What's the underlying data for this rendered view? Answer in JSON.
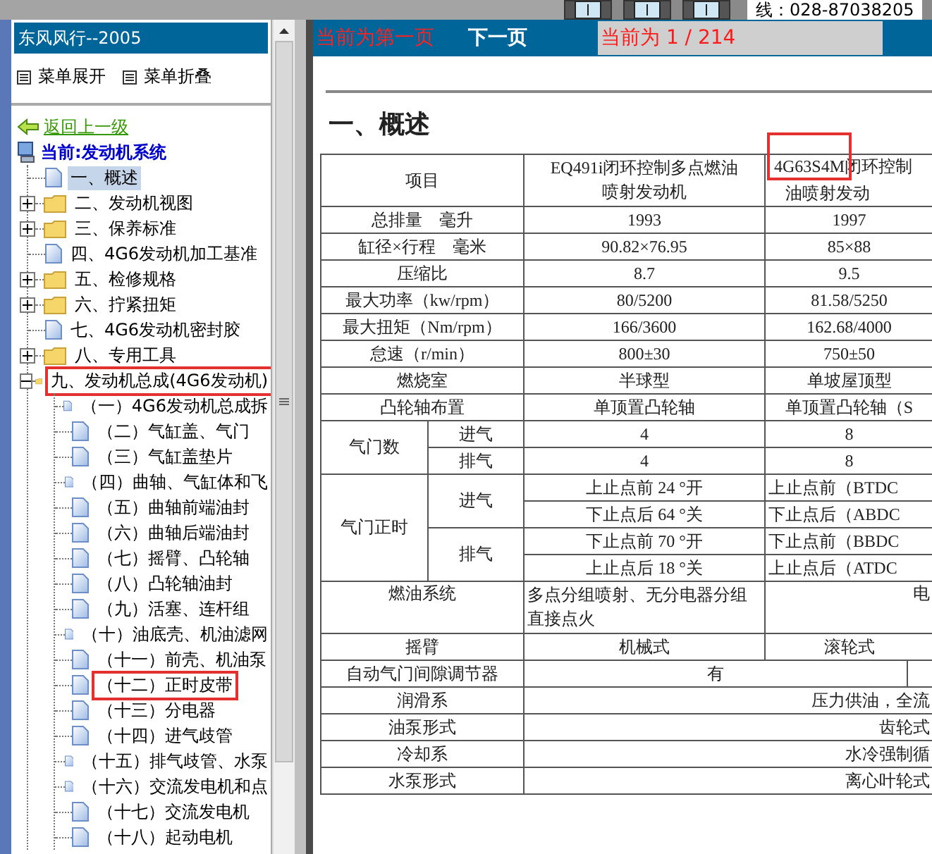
{
  "top_bar": {
    "phone": "线：028-87038205"
  },
  "sidebar": {
    "title": "东风风行--2005",
    "menu_buttons": [
      "菜单展开",
      "菜单折叠"
    ],
    "back_link": "返回上一级",
    "current": "当前:发动机系统",
    "tree": [
      {
        "label": "一、概述",
        "kind": "page",
        "selected": true,
        "highlighted": false
      },
      {
        "label": "二、发动机视图",
        "kind": "folder",
        "expanded": false,
        "selected": false,
        "highlighted": false
      },
      {
        "label": "三、保养标准",
        "kind": "folder",
        "expanded": false,
        "selected": false,
        "highlighted": false
      },
      {
        "label": "四、4G6发动机加工基准",
        "kind": "page",
        "selected": false,
        "highlighted": false
      },
      {
        "label": "五、检修规格",
        "kind": "folder",
        "expanded": false,
        "selected": false,
        "highlighted": false
      },
      {
        "label": "六、拧紧扭矩",
        "kind": "folder",
        "expanded": false,
        "selected": false,
        "highlighted": false
      },
      {
        "label": "七、4G6发动机密封胶",
        "kind": "page",
        "selected": false,
        "highlighted": false
      },
      {
        "label": "八、专用工具",
        "kind": "folder",
        "expanded": false,
        "selected": false,
        "highlighted": false
      },
      {
        "label": "九、发动机总成(4G6发动机)",
        "kind": "folder",
        "expanded": true,
        "selected": false,
        "highlighted": true,
        "children": [
          {
            "label": "（一）4G6发动机总成拆",
            "kind": "page",
            "selected": false,
            "highlighted": false
          },
          {
            "label": "（二）气缸盖、气门",
            "kind": "page",
            "selected": false,
            "highlighted": false
          },
          {
            "label": "（三）气缸盖垫片",
            "kind": "page",
            "selected": false,
            "highlighted": false
          },
          {
            "label": "（四）曲轴、气缸体和飞",
            "kind": "page",
            "selected": false,
            "highlighted": false
          },
          {
            "label": "（五）曲轴前端油封",
            "kind": "page",
            "selected": false,
            "highlighted": false
          },
          {
            "label": "（六）曲轴后端油封",
            "kind": "page",
            "selected": false,
            "highlighted": false
          },
          {
            "label": "（七）摇臂、凸轮轴",
            "kind": "page",
            "selected": false,
            "highlighted": false
          },
          {
            "label": "（八）凸轮轴油封",
            "kind": "page",
            "selected": false,
            "highlighted": false
          },
          {
            "label": "（九）活塞、连杆组",
            "kind": "page",
            "selected": false,
            "highlighted": false
          },
          {
            "label": "（十）油底壳、机油滤网",
            "kind": "page",
            "selected": false,
            "highlighted": false
          },
          {
            "label": "（十一）前壳、机油泵",
            "kind": "page",
            "selected": false,
            "highlighted": false
          },
          {
            "label": "（十二）正时皮带",
            "kind": "page",
            "selected": false,
            "highlighted": true
          },
          {
            "label": "（十三）分电器",
            "kind": "page",
            "selected": false,
            "highlighted": false
          },
          {
            "label": "（十四）进气歧管",
            "kind": "page",
            "selected": false,
            "highlighted": false
          },
          {
            "label": "（十五）排气歧管、水泵",
            "kind": "page",
            "selected": false,
            "highlighted": false
          },
          {
            "label": "（十六）交流发电机和点",
            "kind": "page",
            "selected": false,
            "highlighted": false
          },
          {
            "label": "（十七）交流发电机",
            "kind": "page",
            "selected": false,
            "highlighted": false
          },
          {
            "label": "（十八）起动电机",
            "kind": "page",
            "selected": false,
            "highlighted": false
          }
        ]
      }
    ]
  },
  "content": {
    "prev_status": "当前为第一页",
    "next_link": "下一页",
    "page_indicator": "当前为 1 / 214",
    "heading": "一、概述",
    "table": {
      "header": {
        "label": "项目",
        "columns": [
          {
            "lines": [
              "EQ491i闭环控制多点燃油",
              "喷射发动机"
            ],
            "highlighted": false
          },
          {
            "lines": [
              "4G63S4M闭环控制",
              "油喷射发动"
            ],
            "highlighted": true
          }
        ]
      },
      "rows": [
        {
          "kind": "simple",
          "label": "总排量　毫升",
          "values": [
            "1993",
            "1997"
          ]
        },
        {
          "kind": "simple",
          "label": "缸径×行程　毫米",
          "values": [
            "90.82×76.95",
            "85×88"
          ]
        },
        {
          "kind": "simple",
          "label": "压缩比",
          "values": [
            "8.7",
            "9.5"
          ]
        },
        {
          "kind": "simple",
          "label": "最大功率（kw/rpm）",
          "values": [
            "80/5200",
            "81.58/5250"
          ]
        },
        {
          "kind": "simple",
          "label": "最大扭矩（Nm/rpm）",
          "values": [
            "166/3600",
            "162.68/4000"
          ]
        },
        {
          "kind": "simple",
          "label": "怠速（r/min）",
          "values": [
            "800±30",
            "750±50"
          ]
        },
        {
          "kind": "simple",
          "label": "燃烧室",
          "values": [
            "半球型",
            "单坡屋顶型"
          ]
        },
        {
          "kind": "simple",
          "label": "凸轮轴布置",
          "values": [
            "单顶置凸轮轴",
            "单顶置凸轮轴（S"
          ]
        },
        {
          "kind": "group",
          "label": "气门数",
          "subrows": [
            {
              "label": "进气",
              "values": [
                "4",
                "8"
              ]
            },
            {
              "label": "排气",
              "values": [
                "4",
                "8"
              ]
            }
          ]
        },
        {
          "kind": "timing",
          "label": "气门正时",
          "subrows": [
            {
              "label": "进气",
              "lines": [
                [
                  "上止点前 24 °开",
                  "上止点前（BTDC"
                ],
                [
                  "下止点后 64 °关",
                  "下止点后（ABDC"
                ]
              ]
            },
            {
              "label": "排气",
              "lines": [
                [
                  "下止点前 70 °开",
                  "下止点前（BBDC"
                ],
                [
                  "上止点后 18 °关",
                  "上止点后（ATDC"
                ]
              ]
            }
          ]
        },
        {
          "kind": "wrapped",
          "label": "燃油系统",
          "values": [
            "多点分组喷射、无分电器分组直接点火",
            "电"
          ]
        },
        {
          "kind": "simple",
          "label": "摇臂",
          "values": [
            "机械式",
            "滚轮式"
          ]
        },
        {
          "kind": "split",
          "label": "自动气门间隙调节器",
          "value": "有"
        },
        {
          "kind": "wide",
          "label": "润滑系",
          "value": "压力供油，全流"
        },
        {
          "kind": "wide",
          "label": "油泵形式",
          "value": "齿轮式"
        },
        {
          "kind": "wide",
          "label": "冷却系",
          "value": "水冷强制循"
        },
        {
          "kind": "wide",
          "label": "水泵形式",
          "value": "离心叶轮式"
        }
      ]
    }
  }
}
